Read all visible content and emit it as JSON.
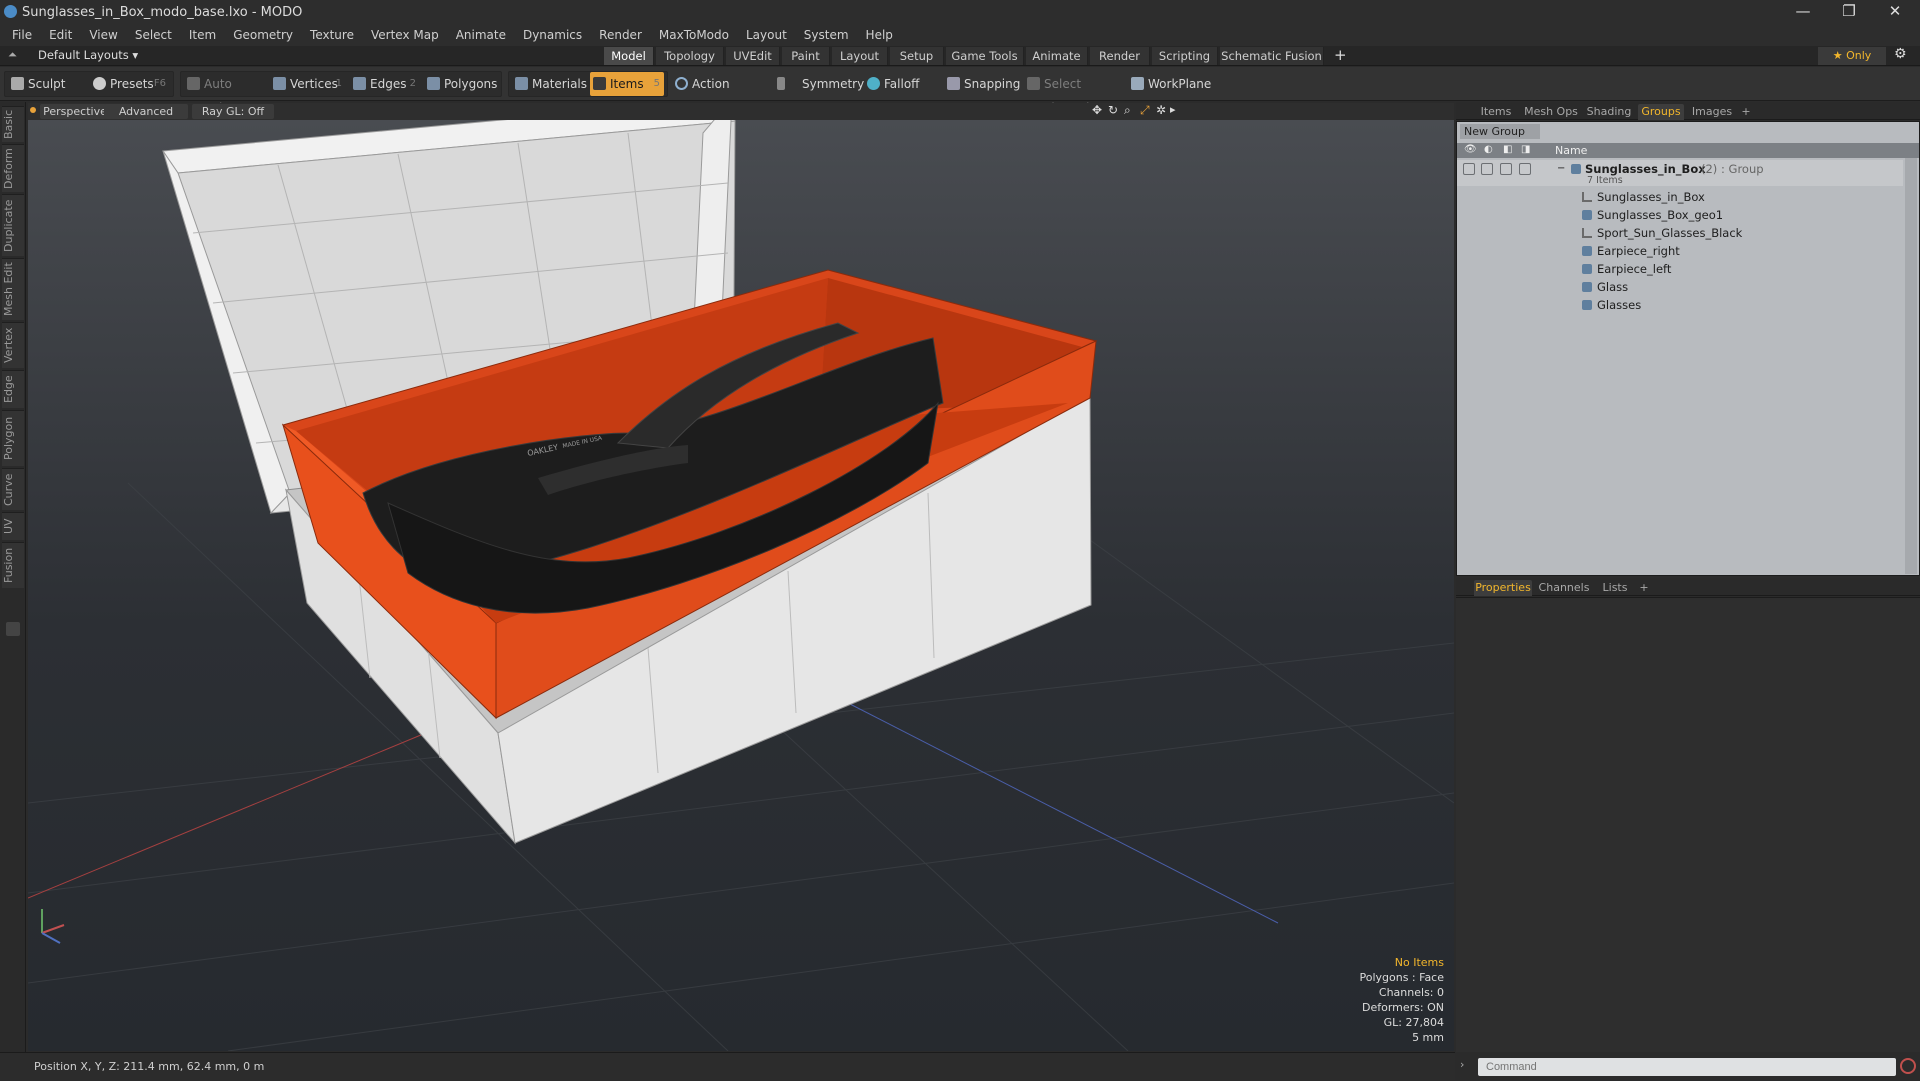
{
  "window": {
    "title": "Sunglasses_in_Box_modo_base.lxo - MODO",
    "controls": [
      "—",
      "❐",
      "✕"
    ]
  },
  "menu": [
    "File",
    "Edit",
    "View",
    "Select",
    "Item",
    "Geometry",
    "Texture",
    "Vertex Map",
    "Animate",
    "Dynamics",
    "Render",
    "MaxToModo",
    "Layout",
    "System",
    "Help"
  ],
  "layouts": {
    "current": "Default Layouts ▾",
    "tabs": [
      "Model",
      "Topology",
      "UVEdit",
      "Paint",
      "Layout",
      "Setup",
      "Game Tools",
      "Animate",
      "Render",
      "Scripting",
      "Schematic Fusion"
    ],
    "active_tab": "Model",
    "add": "+",
    "only_label": "★ Only",
    "gear": "⚙"
  },
  "toolbar": {
    "sculpt": "Sculpt",
    "presets": "Presets",
    "presets_key": "F6",
    "auto_select": "Auto Select",
    "vertices": "Vertices",
    "vertices_key": "1",
    "edges": "Edges",
    "edges_key": "2",
    "polygons": "Polygons",
    "materials": "Materials",
    "items": "Items",
    "items_key": "5",
    "action_center": "Action Center",
    "symmetry": "Symmetry",
    "falloff": "Falloff",
    "snapping": "Snapping",
    "select_through": "Select Through",
    "workplane": "WorkPlane"
  },
  "left_tabs": [
    "Basic",
    "Deform",
    "Duplicate",
    "Mesh Edit",
    "Vertex",
    "Edge",
    "Polygon",
    "Curve",
    "UV",
    "Fusion"
  ],
  "viewport": {
    "view": "Perspective",
    "shading": "Advanced",
    "ray_gl": "Ray GL: Off",
    "stats": {
      "selection": "No Items",
      "polygons": "Polygons : Face",
      "channels": "Channels: 0",
      "deformers": "Deformers: ON",
      "gl": "GL: 27,804",
      "grid": "5 mm"
    },
    "logo_text": "OAKLEY",
    "made_in": "MADE IN USA"
  },
  "status": {
    "position": "Position X, Y, Z:   211.4 mm, 62.4 mm, 0 m"
  },
  "right_panel": {
    "top_tabs": [
      "Items",
      "Mesh Ops",
      "Shading",
      "Groups",
      "Images",
      "+"
    ],
    "active_top": "Groups",
    "new_group": "New Group",
    "col_name": "Name",
    "group": {
      "name": "Sunglasses_in_Box",
      "count": "(2)",
      "type": ": Group",
      "sub": "7 Items"
    },
    "items": [
      "Sunglasses_in_Box",
      "Sunglasses_Box_geo1",
      "Sport_Sun_Glasses_Black",
      "Earpiece_right",
      "Earpiece_left",
      "Glass",
      "Glasses"
    ],
    "bottom_tabs": [
      "Properties",
      "Channels",
      "Lists",
      "+"
    ],
    "active_bottom": "Properties",
    "command_placeholder": "Command"
  },
  "colors": {
    "accent": "#f2b62c",
    "box_orange": "#e24a1a",
    "box_white": "#e2e2e2"
  }
}
